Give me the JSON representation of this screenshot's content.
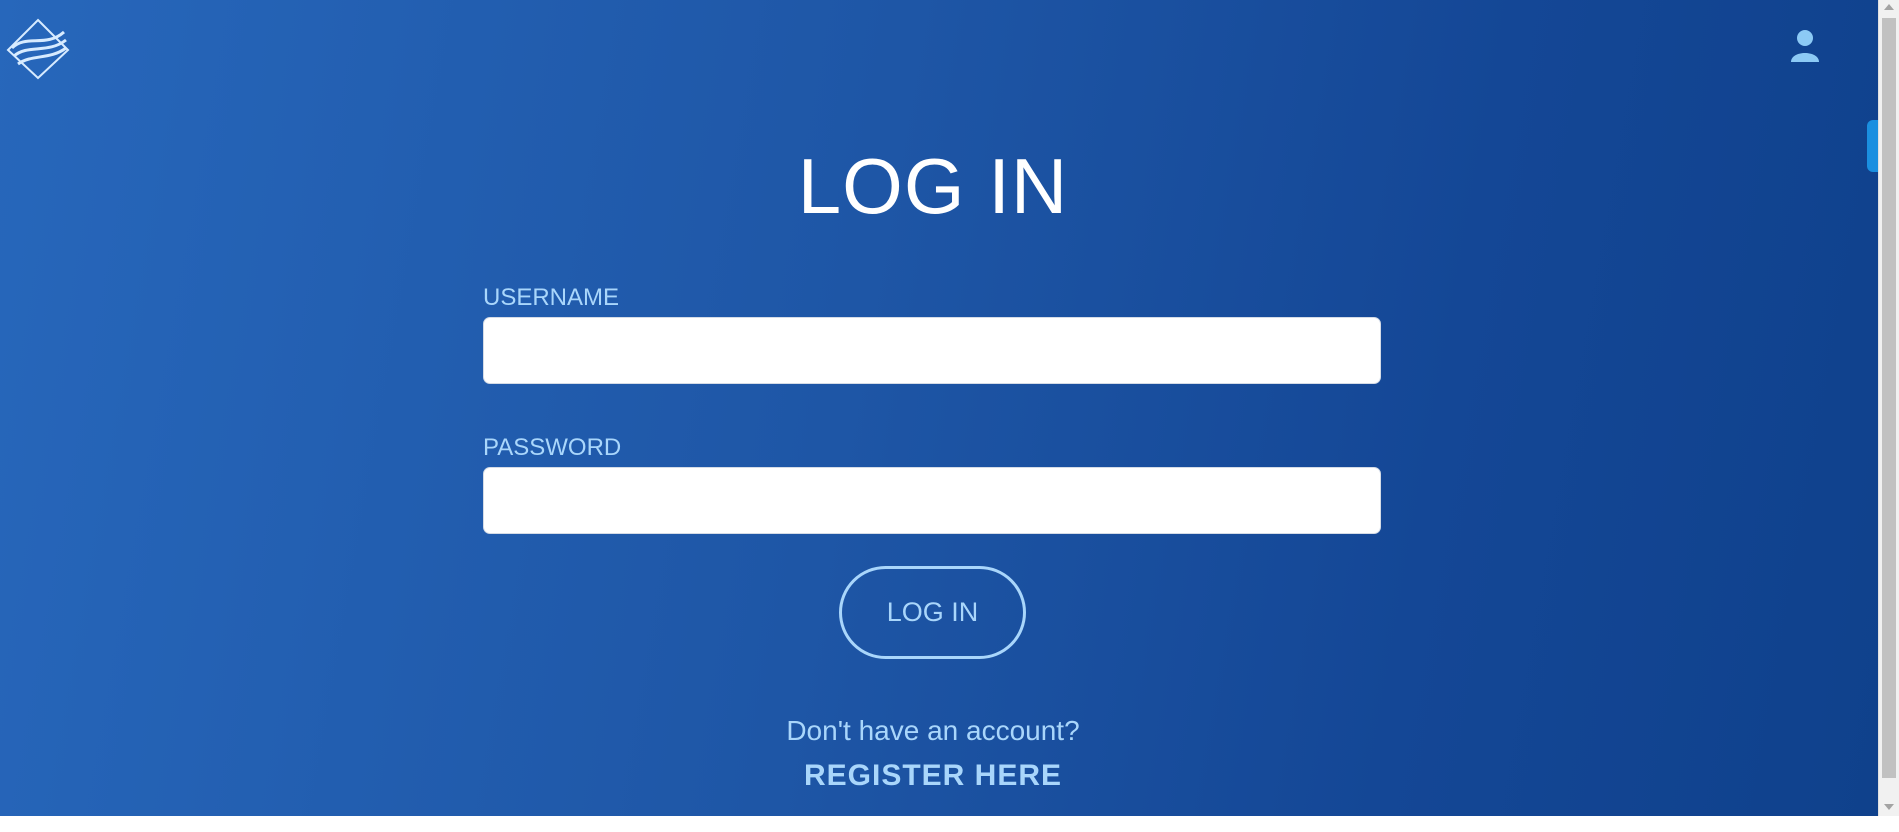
{
  "header": {
    "logo_icon": "wave-diamond-logo-icon",
    "user_icon": "user-icon"
  },
  "login": {
    "title": "LOG IN",
    "username_label": "USERNAME",
    "username_value": "",
    "password_label": "PASSWORD",
    "password_value": "",
    "submit_label": "LOG IN",
    "no_account_text": "Don't have an account?",
    "register_label": "REGISTER HERE"
  },
  "colors": {
    "background_start": "#2767bb",
    "background_end": "#0f418c",
    "accent_light_blue": "#a9d6fb",
    "side_tab": "#1a8fe0"
  }
}
